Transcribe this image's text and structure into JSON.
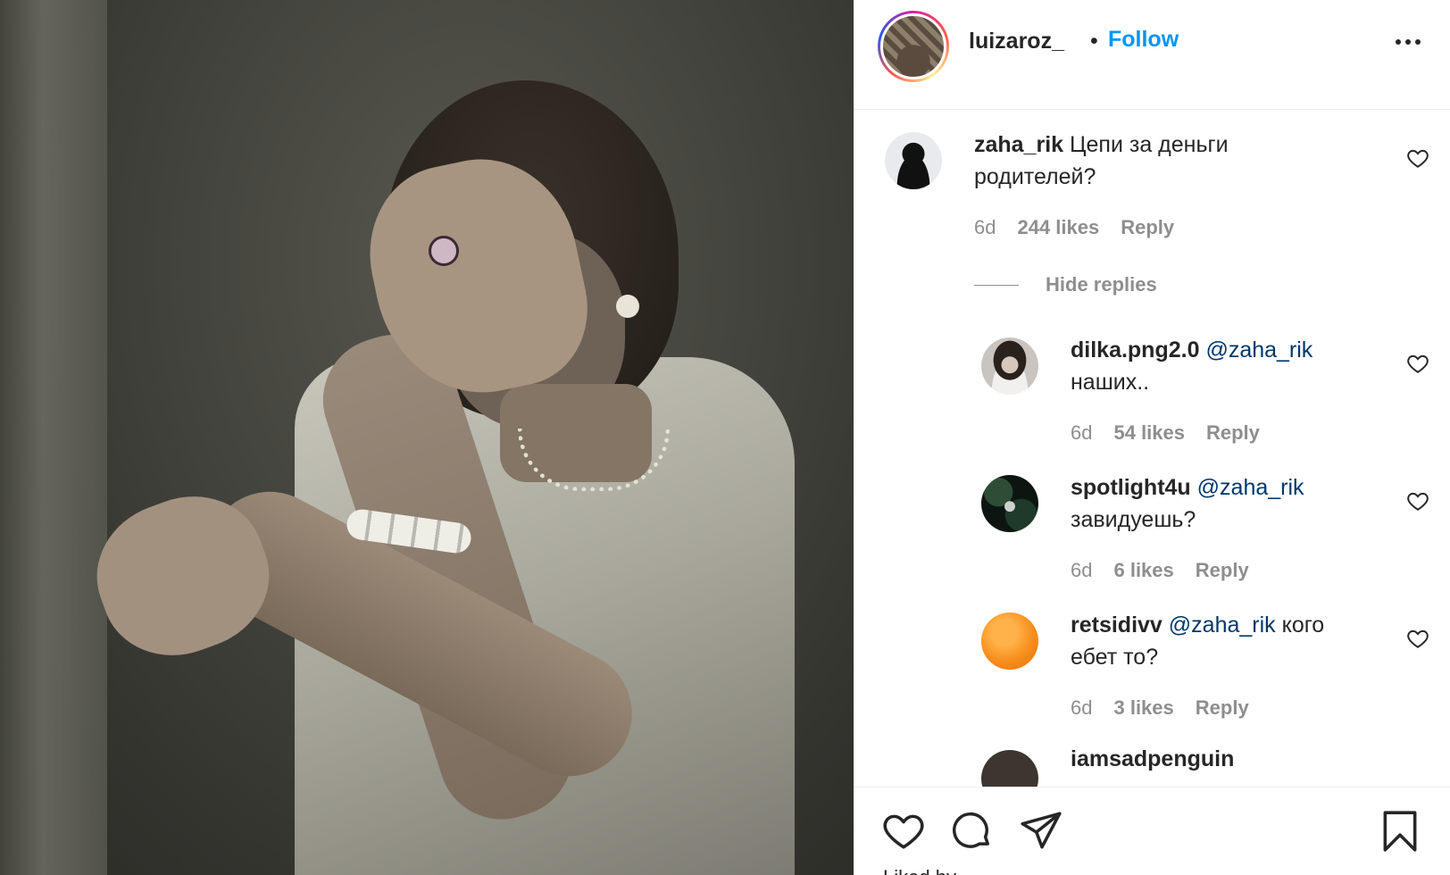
{
  "post": {
    "username": "luizaroz_",
    "separator": "•",
    "follow_label": "Follow",
    "more_icon": "more-horizontal-icon"
  },
  "comments": [
    {
      "username": "zaha_rik",
      "text": "Цепи за деньги",
      "text_line2": "родителей?",
      "time": "6d",
      "likes": "244 likes",
      "reply": "Reply",
      "hide_replies": "Hide replies"
    }
  ],
  "replies": [
    {
      "username": "dilka.png2.0",
      "mention": "@zaha_rik",
      "text": "",
      "text_line2": "наших..",
      "time": "6d",
      "likes": "54 likes",
      "reply": "Reply"
    },
    {
      "username": "spotlight4u",
      "mention": "@zaha_rik",
      "text": "",
      "text_line2": "завидуешь?",
      "time": "6d",
      "likes": "6 likes",
      "reply": "Reply"
    },
    {
      "username": "retsidivv",
      "mention": "@zaha_rik",
      "text": " кого",
      "text_line2": "ебет то?",
      "time": "6d",
      "likes": "3 likes",
      "reply": "Reply"
    },
    {
      "username": "iamsadpenguin"
    }
  ],
  "actions": {
    "like_icon": "heart-icon",
    "comment_icon": "comment-icon",
    "share_icon": "paper-plane-icon",
    "save_icon": "bookmark-icon",
    "liked_by_prefix": "Liked by"
  },
  "colors": {
    "link": "#0095f6",
    "mention": "#00376b",
    "muted": "#8e8e8e",
    "text": "#262626"
  }
}
